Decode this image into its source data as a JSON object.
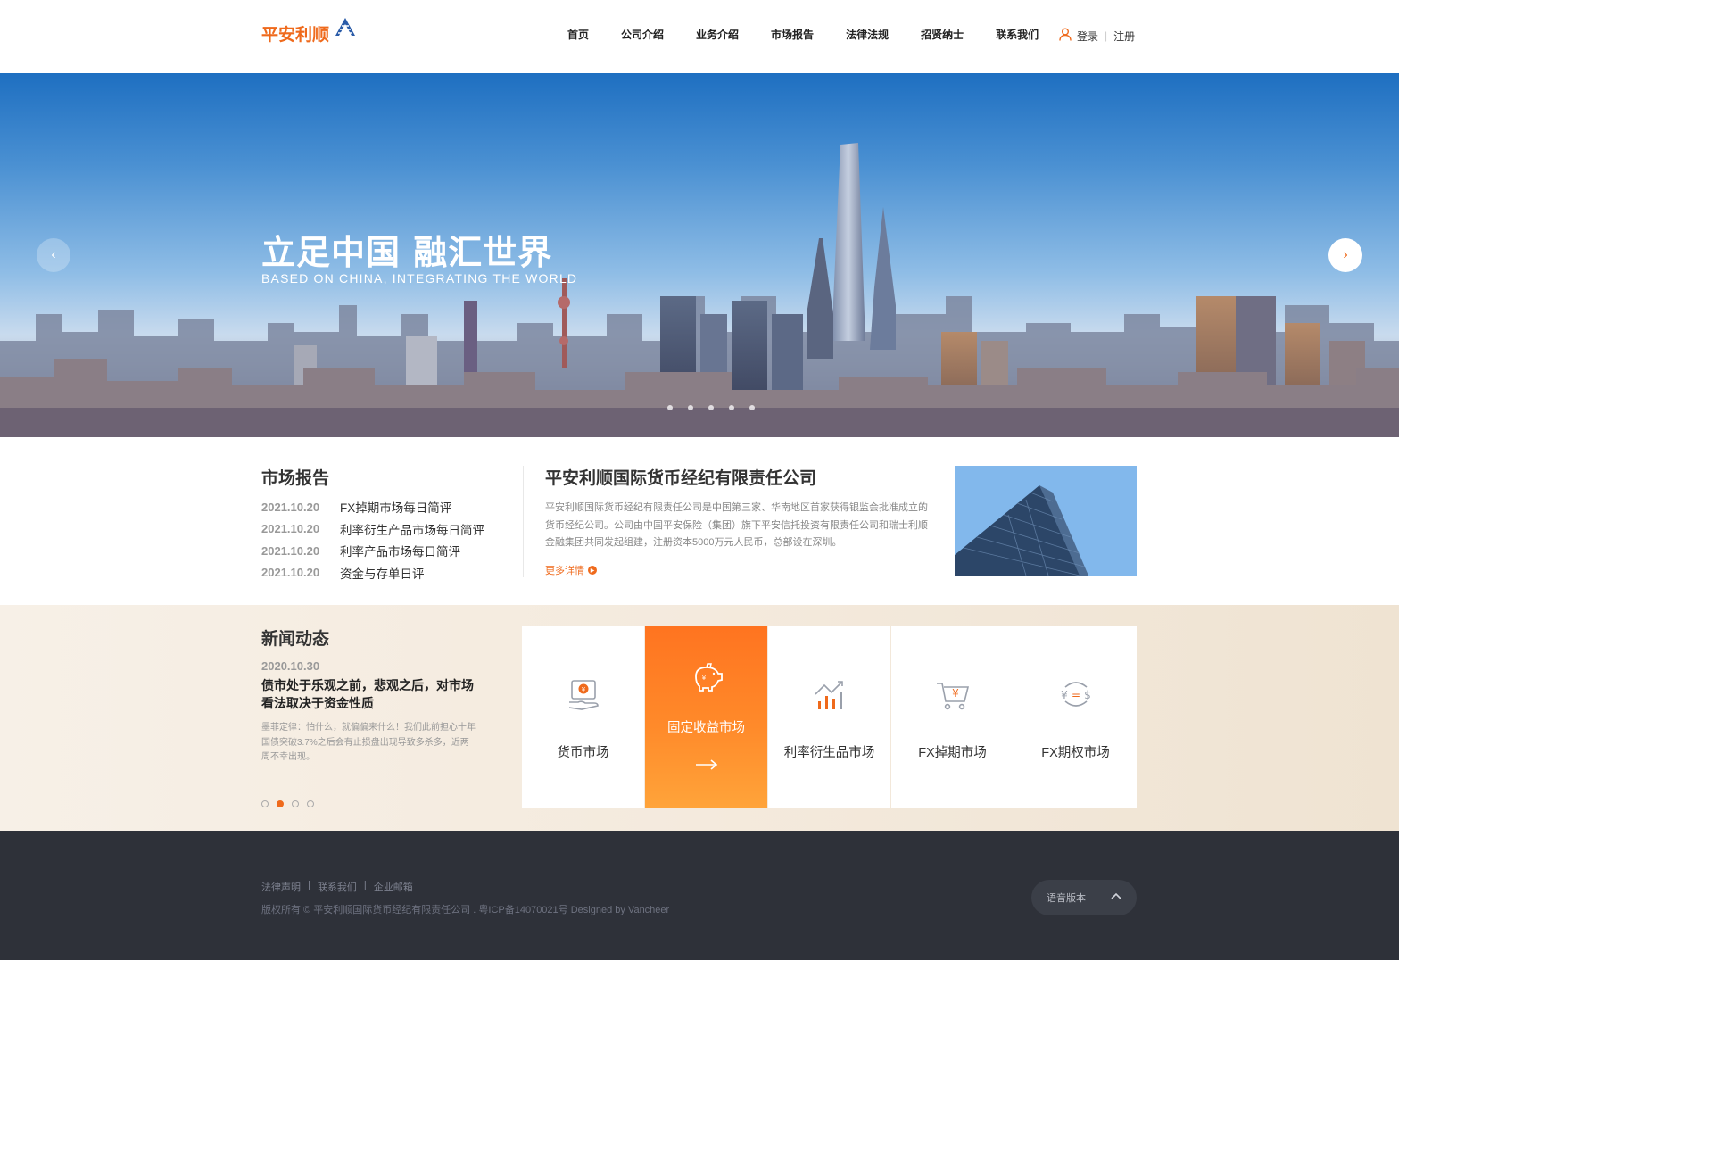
{
  "brand": {
    "name": "平安利顺",
    "accent": "#ef6a1c",
    "logo_icon": "triangle-stripes-logo-icon"
  },
  "nav": {
    "items": [
      "首页",
      "公司介绍",
      "业务介绍",
      "市场报告",
      "法律法规",
      "招贤纳士",
      "联系我们"
    ]
  },
  "user": {
    "icon": "user-icon",
    "login": "登录",
    "register": "注册"
  },
  "banner": {
    "title": "立足中国  融汇世界",
    "subtitle": "BASED ON CHINA, INTEGRATING THE WORLD",
    "prev_icon": "chevron-left-icon",
    "next_icon": "chevron-right-icon",
    "slide_count": 5
  },
  "market": {
    "title": "市场报告",
    "reports": [
      {
        "date": "2021.10.20",
        "title": "FX掉期市场每日简评"
      },
      {
        "date": "2021.10.20",
        "title": "利率衍生产品市场每日简评"
      },
      {
        "date": "2021.10.20",
        "title": "利率产品市场每日简评"
      },
      {
        "date": "2021.10.20",
        "title": "资金与存单日评"
      }
    ]
  },
  "about": {
    "title": "平安利顺国际货币经纪有限责任公司",
    "text": "平安利顺国际货币经纪有限责任公司是中国第三家、华南地区首家获得银监会批准成立的货币经纪公司。公司由中国平安保险（集团）旗下平安信托投资有限责任公司和瑞士利顺金融集团共同发起组建，注册资本5000万元人民币，总部设在深圳。",
    "more": "更多详情"
  },
  "news": {
    "title": "新闻动态",
    "date": "2020.10.30",
    "headline": "债市处于乐观之前，悲观之后，对市场看法取决于资金性质",
    "body": "墨菲定律：怕什么，就偏偏来什么！我们此前担心十年国债突破3.7%之后会有止损盘出现导致多杀多，近两周不幸出现。",
    "pages": 4,
    "active_page": 2
  },
  "services": [
    {
      "label": "货币市场",
      "icon": "hand-money-icon",
      "active": false
    },
    {
      "label": "固定收益市场",
      "icon": "piggy-bank-icon",
      "active": true
    },
    {
      "label": "利率衍生品市场",
      "icon": "bar-chart-trend-icon",
      "active": false
    },
    {
      "label": "FX掉期市场",
      "icon": "shopping-cart-icon",
      "active": false
    },
    {
      "label": "FX期权市场",
      "icon": "currency-exchange-icon",
      "active": false
    }
  ],
  "footer": {
    "links": [
      "法律声明",
      "联系我们",
      "企业邮箱"
    ],
    "copyright": "版权所有 © 平安利顺国际货币经纪有限责任公司 .   粤ICP备14070021号 Designed by Vancheer",
    "language": "语音版本"
  }
}
